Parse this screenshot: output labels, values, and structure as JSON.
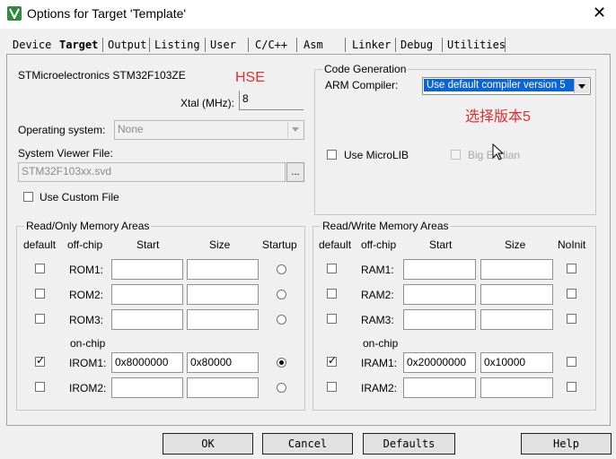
{
  "window": {
    "title": "Options for Target 'Template'",
    "close": "✕"
  },
  "tabs": [
    {
      "label": "Device"
    },
    {
      "label": "Target"
    },
    {
      "label": "Output"
    },
    {
      "label": "Listing"
    },
    {
      "label": "User"
    },
    {
      "label": "C/C++"
    },
    {
      "label": "Asm"
    },
    {
      "label": "Linker"
    },
    {
      "label": "Debug"
    },
    {
      "label": "Utilities"
    }
  ],
  "target": {
    "device_name": "STMicroelectronics STM32F103ZE",
    "annot_hse": "HSE",
    "xtal_label": "Xtal (MHz):",
    "xtal_value": "8",
    "os_label": "Operating system:",
    "os_value": "None",
    "svf_label": "System Viewer File:",
    "svf_value": "STM32F103xx.svd",
    "svf_browse": "...",
    "custom_file_label": "Use Custom File"
  },
  "codegen": {
    "title": "Code Generation",
    "compiler_label": "ARM Compiler:",
    "compiler_value": "Use default compiler version 5",
    "annot_choose": "选择版本5",
    "microlib_label": "Use MicroLIB",
    "big_endian_label": "Big Endian"
  },
  "rom_group": {
    "title": "Read/Only Memory Areas",
    "headers": {
      "default": "default",
      "offchip": "off-chip",
      "start": "Start",
      "size": "Size",
      "startup": "Startup"
    },
    "onchip_label": "on-chip",
    "rows": [
      {
        "label": "ROM1:",
        "start": "",
        "size": "",
        "checked": false,
        "startup": false
      },
      {
        "label": "ROM2:",
        "start": "",
        "size": "",
        "checked": false,
        "startup": false
      },
      {
        "label": "ROM3:",
        "start": "",
        "size": "",
        "checked": false,
        "startup": false
      },
      {
        "label": "IROM1:",
        "start": "0x8000000",
        "size": "0x80000",
        "checked": true,
        "startup": true
      },
      {
        "label": "IROM2:",
        "start": "",
        "size": "",
        "checked": false,
        "startup": false
      }
    ]
  },
  "ram_group": {
    "title": "Read/Write Memory Areas",
    "headers": {
      "default": "default",
      "offchip": "off-chip",
      "start": "Start",
      "size": "Size",
      "noinit": "NoInit"
    },
    "onchip_label": "on-chip",
    "rows": [
      {
        "label": "RAM1:",
        "start": "",
        "size": "",
        "checked": false,
        "noinit": false
      },
      {
        "label": "RAM2:",
        "start": "",
        "size": "",
        "checked": false,
        "noinit": false
      },
      {
        "label": "RAM3:",
        "start": "",
        "size": "",
        "checked": false,
        "noinit": false
      },
      {
        "label": "IRAM1:",
        "start": "0x20000000",
        "size": "0x10000",
        "checked": true,
        "noinit": false
      },
      {
        "label": "IRAM2:",
        "start": "",
        "size": "",
        "checked": false,
        "noinit": false
      }
    ]
  },
  "buttons": {
    "ok": "OK",
    "cancel": "Cancel",
    "defaults": "Defaults",
    "help": "Help"
  }
}
